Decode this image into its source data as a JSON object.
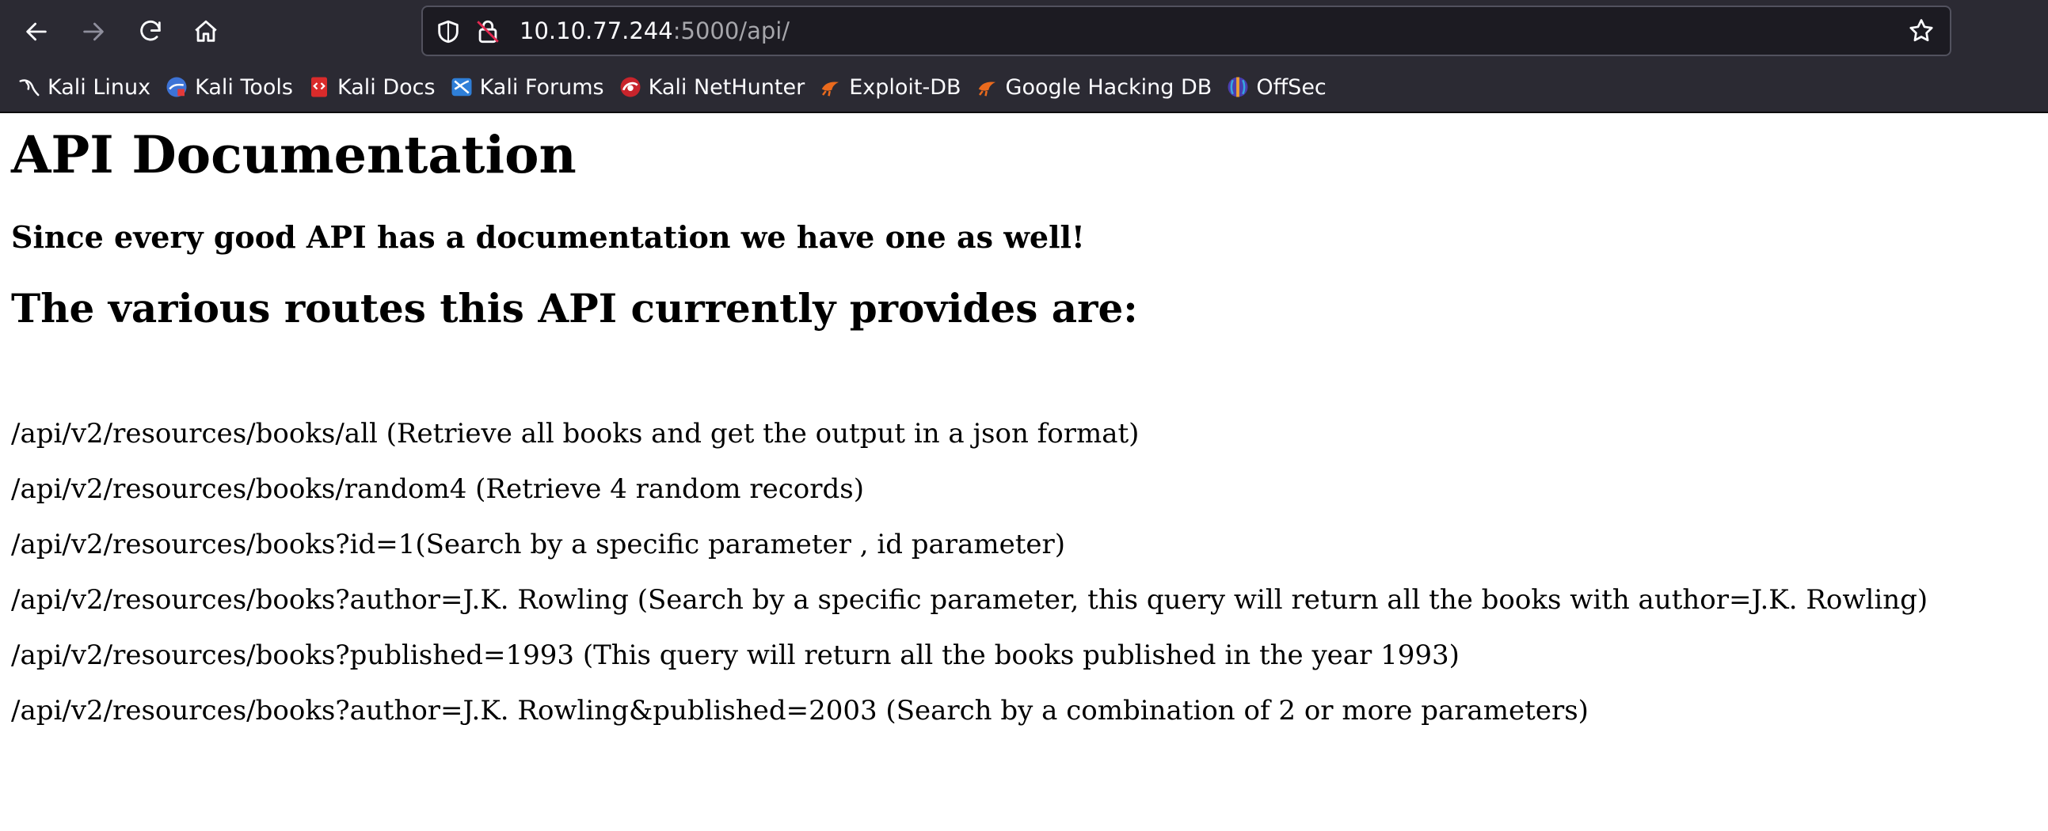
{
  "browser": {
    "url_host": "10.10.77.244",
    "url_rest": ":5000/api/",
    "bookmarks": [
      {
        "label": "Kali Linux",
        "icon": "kali-dragon-icon"
      },
      {
        "label": "Kali Tools",
        "icon": "kali-tools-icon"
      },
      {
        "label": "Kali Docs",
        "icon": "kali-docs-icon"
      },
      {
        "label": "Kali Forums",
        "icon": "kali-forums-icon"
      },
      {
        "label": "Kali NetHunter",
        "icon": "kali-nethunter-icon"
      },
      {
        "label": "Exploit-DB",
        "icon": "exploit-db-icon"
      },
      {
        "label": "Google Hacking DB",
        "icon": "google-hacking-db-icon"
      },
      {
        "label": "OffSec",
        "icon": "offsec-icon"
      }
    ]
  },
  "page": {
    "title": "API Documentation",
    "subtitle": "Since every good API has a documentation we have one as well!",
    "routes_heading": "The various routes this API currently provides are:",
    "routes": [
      "/api/v2/resources/books/all (Retrieve all books and get the output in a json format)",
      "/api/v2/resources/books/random4 (Retrieve 4 random records)",
      "/api/v2/resources/books?id=1(Search by a specific parameter , id parameter)",
      "/api/v2/resources/books?author=J.K. Rowling (Search by a specific parameter, this query will return all the books with author=J.K. Rowling)",
      "/api/v2/resources/books?published=1993 (This query will return all the books published in the year 1993)",
      "/api/v2/resources/books?author=J.K. Rowling&published=2003 (Search by a combination of 2 or more parameters)"
    ]
  }
}
